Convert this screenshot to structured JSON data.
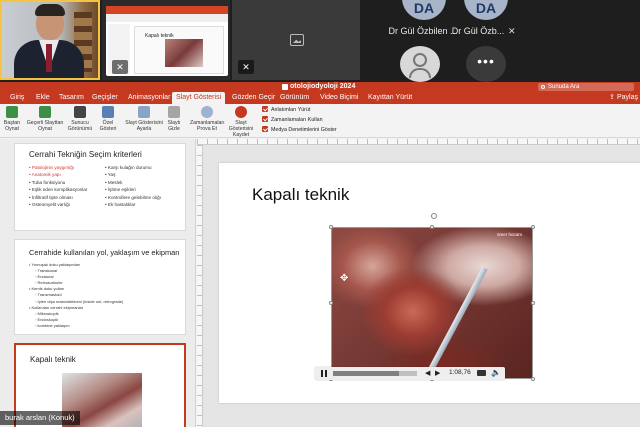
{
  "participants": {
    "da1": {
      "initials": "DA",
      "name": "Dr Gül Özbilen ..."
    },
    "da2": {
      "initials": "DA",
      "name": "Dr Gül Özb..."
    },
    "guest_label": "burak arslan (Konuk)"
  },
  "ppt": {
    "doc_title": "otolojiodyoloji 2024",
    "search_placeholder": "Sunuda Ara",
    "share_label": "Paylaş",
    "tabs": [
      "Giriş",
      "Ekle",
      "Tasarım",
      "Geçişler",
      "Animasyonlar",
      "Slayt Gösterisi",
      "Gözden Geçir",
      "Görünüm",
      "Video Biçimi",
      "Kayıttan Yürüt"
    ],
    "active_tab": "Slayt Gösterisi",
    "ribbon": {
      "buttons": [
        "Baştan Oynat",
        "Geçerli Slayttan Oynat",
        "Sunucu Görünümü",
        "Özel Gösteri",
        "Slayt Gösterisini Ayarla",
        "Slaytı Gizle",
        "Zamanlamaları Prova Et",
        "Slayt Gösterisini Kaydet"
      ],
      "checks": [
        "Anlatımları Yürüt",
        "Zamanlamaları Kullan",
        "Medya Denetimlerini Göster"
      ]
    },
    "thumbnails": [
      {
        "title": "Cerrahi Tekniğin Seçim kriterleri",
        "col1": [
          "• Patolojinin yaygınlığı",
          "• Anatomik yapı",
          "• Tuba fonksiyonu",
          "• Eşlik eden komplikasyonlar",
          "• İnfiltratif tipte olması",
          "• Osteomyelit varlığı"
        ],
        "col1_red": [
          true,
          true,
          false,
          false,
          false,
          false
        ],
        "col2": [
          "• Karşı kulağın durumu",
          "• Yaş",
          "• Meslek",
          "• İşitme eşikleri",
          "• Kontrollere gelebilme olığı",
          "• Ek hastalıklar"
        ]
      },
      {
        "title": "Cerrahide kullanılan yol, yaklaşım ve ekipman",
        "list": [
          "• Yumuşak doku yaklaşımları",
          "  ◦ Transkanal",
          "  ◦ Endaural",
          "  ◦ Retroaurikuler",
          "• Kemik doku yolları",
          "  ◦ Transmastoid",
          "  ◦ İçten dışa mastoidektomi (inside out, retrograde)",
          "• Kullanılan cerrahi ekipmanlar",
          "  ◦ Mikroskopik",
          "  ◦ Endoskopik",
          "  ◦ kombine yaklaşım"
        ]
      },
      {
        "title": "Kapalı teknik"
      }
    ],
    "slide": {
      "title": "Kapalı teknik",
      "video_label": "ömer hocam",
      "time": "1:08,76",
      "progress": 0.78
    }
  }
}
